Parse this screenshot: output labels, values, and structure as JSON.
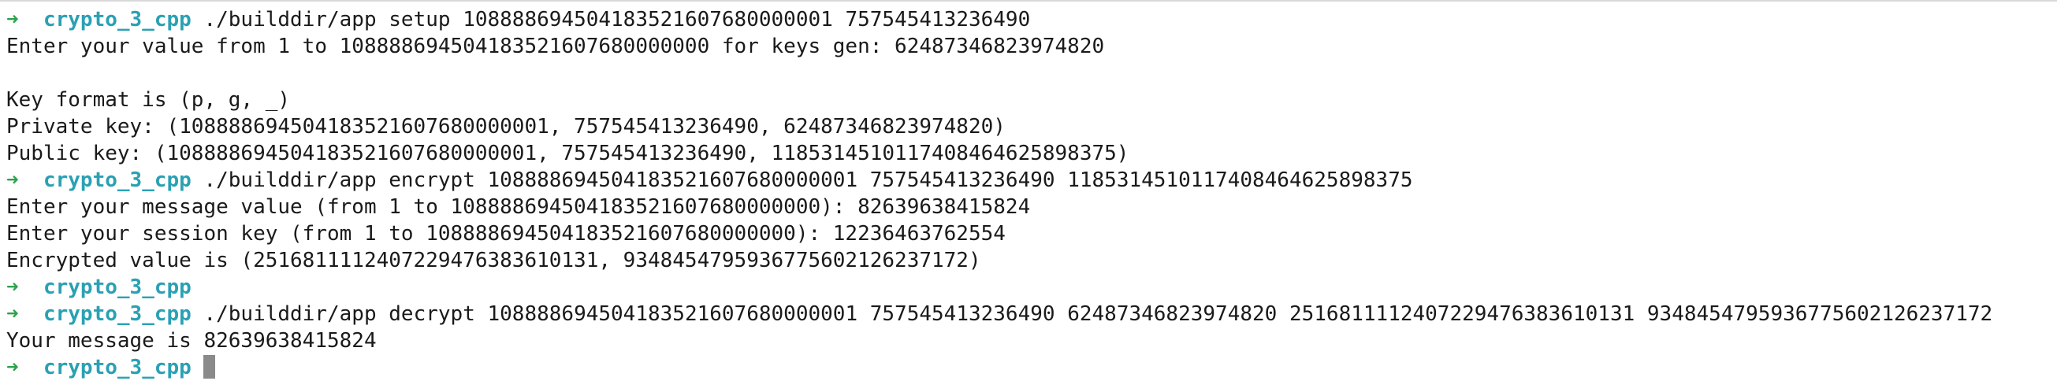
{
  "prompt": {
    "arrow": "➜",
    "dir": "crypto_3_cpp"
  },
  "lines": [
    {
      "type": "prompt",
      "cmd": "./builddir/app setup 108888694504183521607680000001 757545413236490"
    },
    {
      "type": "output",
      "text": "Enter your value from 1 to 108888694504183521607680000000 for keys gen: 62487346823974820"
    },
    {
      "type": "output",
      "text": ""
    },
    {
      "type": "output",
      "text": "Key format is (p, g, _)"
    },
    {
      "type": "output",
      "text": "Private key: (108888694504183521607680000001, 757545413236490, 62487346823974820)"
    },
    {
      "type": "output",
      "text": "Public key: (108888694504183521607680000001, 757545413236490, 118531451011740846462589837​5)"
    },
    {
      "type": "prompt",
      "cmd": "./builddir/app encrypt 108888694504183521607680000001 757545413236490 118531451011740846462589837​5"
    },
    {
      "type": "output",
      "text": "Enter your message value (from 1 to 108888694504183521607680000000): 82639638415824"
    },
    {
      "type": "output",
      "text": "Enter your session key (from 1 to 108888694504183521607680000000): 12236463762554"
    },
    {
      "type": "output",
      "text": "Encrypted value is (25168111124072294763836101​31, 93484547959367756021262371​72)"
    },
    {
      "type": "prompt",
      "cmd": ""
    },
    {
      "type": "prompt",
      "cmd": "./builddir/app decrypt 108888694504183521607680000001 757545413236490 62487346823974820 25168111124072294763836101​31 93484547959367756021262371​72"
    },
    {
      "type": "output",
      "text": "Your message is 82639638415824"
    },
    {
      "type": "prompt",
      "cmd": "",
      "cursor": true
    }
  ]
}
